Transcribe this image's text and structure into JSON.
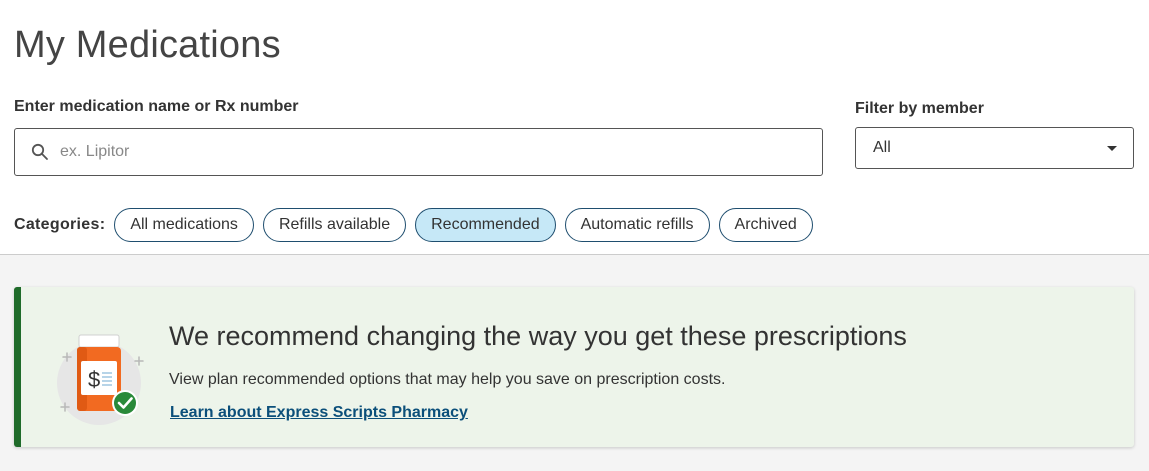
{
  "page": {
    "title": "My Medications"
  },
  "search": {
    "label": "Enter medication name or Rx number",
    "placeholder": "ex. Lipitor",
    "value": "",
    "icon": "search-icon"
  },
  "filter": {
    "label": "Filter by member",
    "selected": "All",
    "icon": "chevron-down-icon"
  },
  "categories": {
    "label": "Categories:",
    "items": [
      {
        "label": "All medications",
        "active": false
      },
      {
        "label": "Refills available",
        "active": false
      },
      {
        "label": "Recommended",
        "active": true
      },
      {
        "label": "Automatic refills",
        "active": false
      },
      {
        "label": "Archived",
        "active": false
      }
    ]
  },
  "banner": {
    "heading": "We recommend changing the way you get these prescriptions",
    "text": "View plan recommended options that may help you save on prescription costs.",
    "link": "Learn about Express Scripts Pharmacy",
    "illustration": "pill-bottle-savings-icon",
    "accent_color": "#1f6b2a"
  },
  "colors": {
    "chip_border": "#1f4e6f",
    "chip_active_bg": "#c6e8f7",
    "banner_bg": "#edf4ea",
    "link": "#0b4f7a"
  }
}
